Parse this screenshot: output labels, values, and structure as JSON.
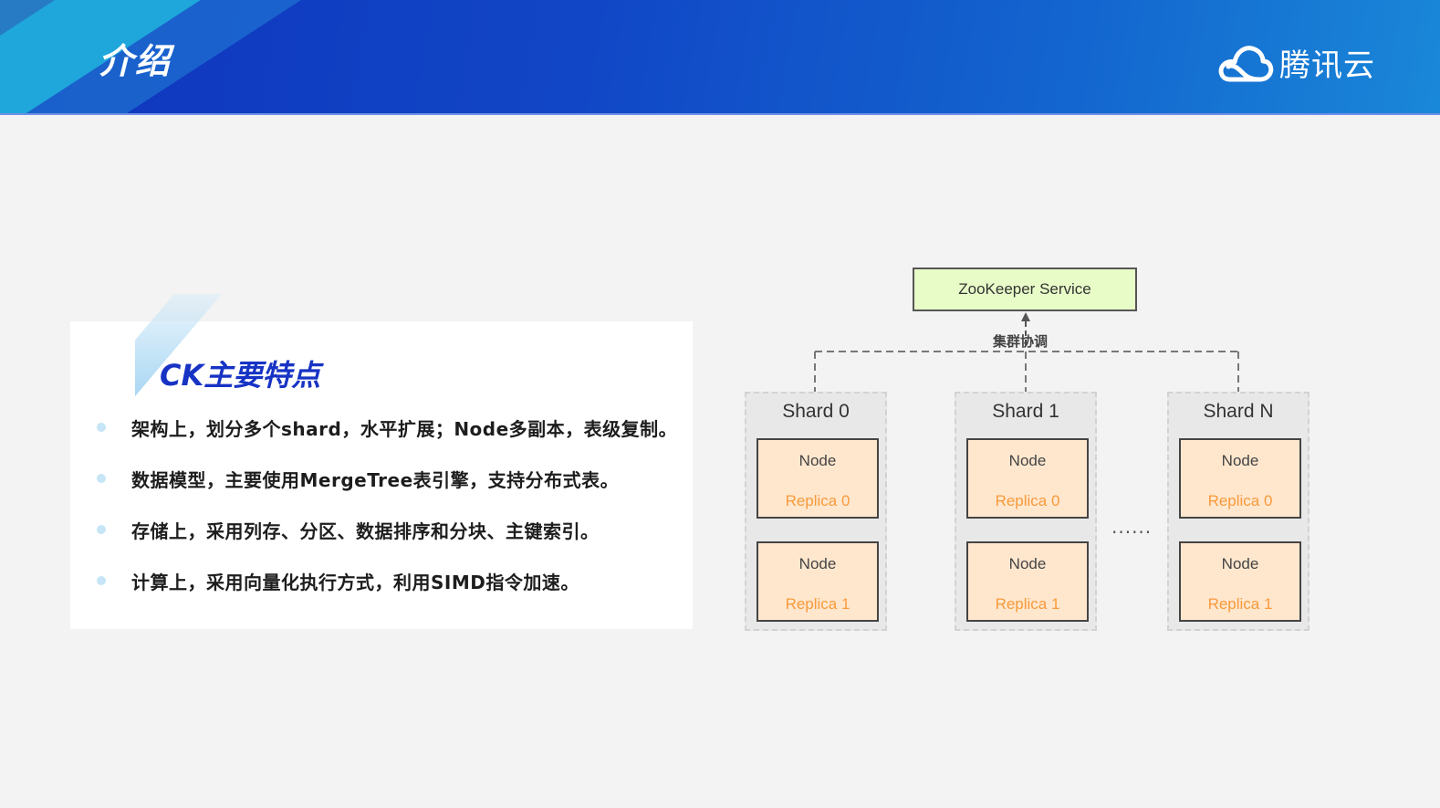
{
  "header": {
    "title": "介绍",
    "brand": {
      "logo_icon": "tencent-cloud-logo-icon",
      "name": "腾讯云"
    }
  },
  "colors": {
    "header_blue": "#1146c6",
    "title_blue": "#1733c4",
    "zk_fill": "#e8fcc8",
    "node_fill": "#ffe7ce",
    "replica_orange": "#f89a3a",
    "bullet": "#c6e6f7"
  },
  "card": {
    "title": "CK主要特点",
    "features": [
      "架构上，划分多个shard，水平扩展；Node多副本，表级复制。",
      "数据模型，主要使用MergeTree表引擎，支持分布式表。",
      "存储上，采用列存、分区、数据排序和分块、主键索引。",
      "计算上，采用向量化执行方式，利用SIMD指令加速。"
    ]
  },
  "diagram": {
    "zookeeper": "ZooKeeper Service",
    "coordination_label": "集群协调",
    "ellipsis": "......",
    "shards": [
      {
        "title": "Shard 0",
        "nodes": [
          {
            "label": "Node",
            "replica": "Replica 0"
          },
          {
            "label": "Node",
            "replica": "Replica 1"
          }
        ]
      },
      {
        "title": "Shard 1",
        "nodes": [
          {
            "label": "Node",
            "replica": "Replica 0"
          },
          {
            "label": "Node",
            "replica": "Replica 1"
          }
        ]
      },
      {
        "title": "Shard N",
        "nodes": [
          {
            "label": "Node",
            "replica": "Replica 0"
          },
          {
            "label": "Node",
            "replica": "Replica 1"
          }
        ]
      }
    ]
  }
}
